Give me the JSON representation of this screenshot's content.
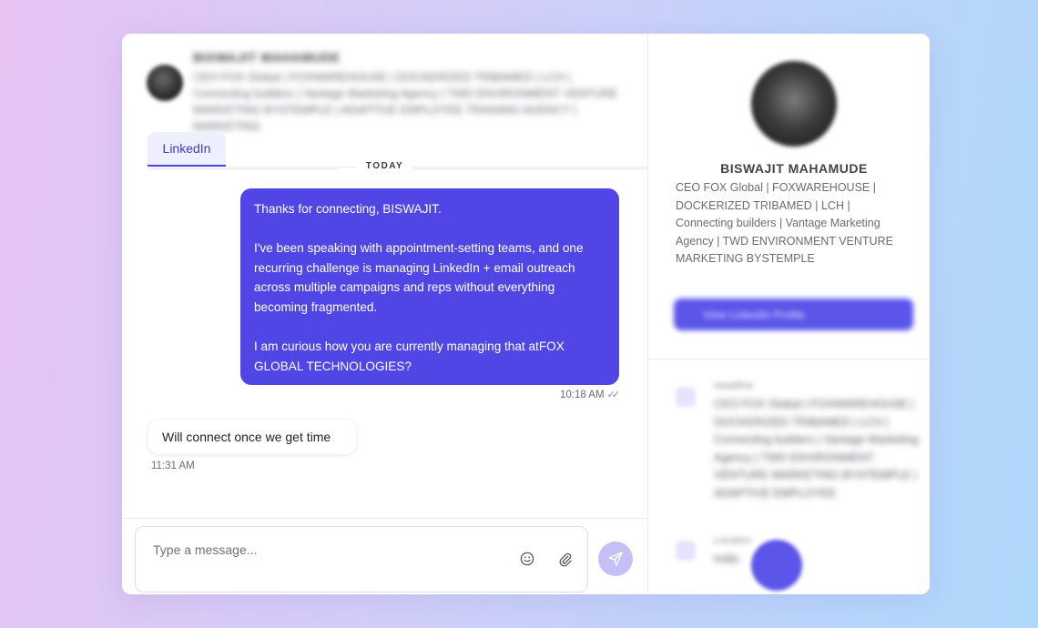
{
  "header": {
    "name": "BISWAJIT MAHAMUDE",
    "bio": "CEO FOX Global | FOXWAREHOUSE | DOCKERIZED TRIBAMED | LCH | Connecting builders | Vantage Marketing Agency | TWD ENVIRONMENT VENTURE MARKETING BYSTEMPLE | ADAPTIVE EMPLOYEE TRAINING AGENCY | MARKETING"
  },
  "tabs": [
    {
      "label": "LinkedIn"
    }
  ],
  "date_separator": "TODAY",
  "messages": {
    "outgoing": {
      "paragraphs": [
        "Thanks for connecting, BISWAJIT.",
        "I've been speaking with appointment-setting teams, and one recurring challenge is managing LinkedIn + email outreach across multiple campaigns and reps without everything becoming fragmented.",
        "I am curious how you are currently managing that atFOX GLOBAL TECHNOLOGIES?"
      ],
      "time": "10:18 AM",
      "status_icon": "double-check-icon"
    },
    "incoming": {
      "text": "Will connect once we get time",
      "time": "11:31 AM"
    }
  },
  "composer": {
    "placeholder": "Type a message...",
    "emoji_icon": "emoji-icon",
    "attach_icon": "paperclip-icon",
    "send_icon": "send-icon"
  },
  "profile": {
    "name": "BISWAJIT MAHAMUDE",
    "bio": "CEO FOX Global | FOXWAREHOUSE | DOCKERIZED TRIBAMED | LCH | Connecting builders | Vantage Marketing Agency | TWD ENVIRONMENT VENTURE MARKETING BYSTEMPLE",
    "view_button": "View LinkedIn Profile",
    "fields": [
      {
        "label": "Headline",
        "value": "CEO FOX Global | FOXWAREHOUSE | DOCKERIZED TRIBAMED | LCH | Connecting builders | Vantage Marketing Agency | TWD ENVIRONMENT VENTURE MARKETING BYSTEMPLE | ADAPTIVE EMPLOYEE"
      },
      {
        "label": "Location",
        "value": "India"
      }
    ]
  },
  "colors": {
    "accent": "#4f46e5",
    "send_button": "#c4c0f6",
    "tab_bg": "#eef0ff"
  }
}
